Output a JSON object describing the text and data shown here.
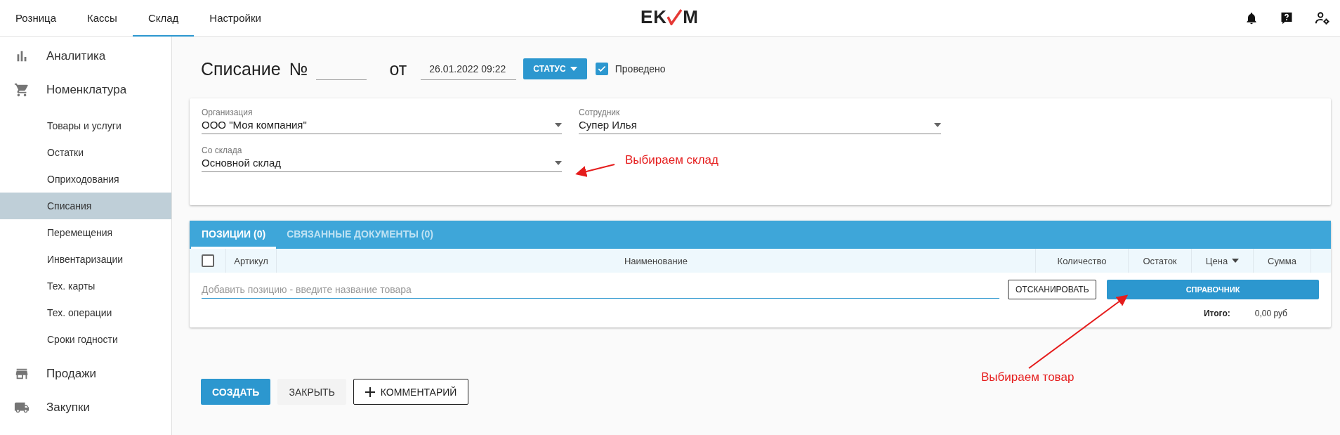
{
  "top_nav": {
    "tabs": [
      {
        "label": "Розница",
        "selected": false
      },
      {
        "label": "Кассы",
        "selected": false
      },
      {
        "label": "Склад",
        "selected": true
      },
      {
        "label": "Настройки",
        "selected": false
      }
    ],
    "logo": {
      "left": "EK",
      "right": "M"
    }
  },
  "sidebar": {
    "items": [
      {
        "label": "Аналитика",
        "selected": false
      },
      {
        "label": "Номенклатура",
        "selected": false,
        "children": [
          {
            "label": "Товары и услуги",
            "selected": false
          },
          {
            "label": "Остатки",
            "selected": false
          },
          {
            "label": "Оприходования",
            "selected": false
          },
          {
            "label": "Списания",
            "selected": true
          },
          {
            "label": "Перемещения",
            "selected": false
          },
          {
            "label": "Инвентаризации",
            "selected": false
          },
          {
            "label": "Тех. карты",
            "selected": false
          },
          {
            "label": "Тех. операции",
            "selected": false
          },
          {
            "label": "Сроки годности",
            "selected": false
          }
        ]
      },
      {
        "label": "Продажи",
        "selected": false
      },
      {
        "label": "Закупки",
        "selected": false
      }
    ]
  },
  "document": {
    "title": "Списание",
    "number_label": "№",
    "date_label": "от",
    "date": "26.01.2022 09:22",
    "status_button": "СТАТУС",
    "posted": {
      "label": "Проведено",
      "checked": true
    }
  },
  "fields": [
    {
      "label": "Организация",
      "value": "ООО \"Моя компания\""
    },
    {
      "label": "Сотрудник",
      "value": "Супер Илья"
    },
    {
      "label": "Со склада",
      "value": "Основной склад"
    }
  ],
  "positions": {
    "tabs": [
      {
        "label": "ПОЗИЦИИ (0)",
        "selected": true
      },
      {
        "label": "СВЯЗАННЫЕ ДОКУМЕНТЫ (0)",
        "selected": false
      }
    ],
    "select_all": {
      "checked": false
    },
    "columns": [
      "Артикул",
      "Наименование",
      "Количество",
      "Остаток",
      "Цена",
      "Сумма"
    ],
    "add_placeholder": "Добавить позицию - введите название товара",
    "scan_button": "ОТСКАНИРОВАТЬ",
    "catalog_button": "СПРАВОЧНИК",
    "total_label": "Итого:",
    "total_value": "0,00 руб"
  },
  "actions": [
    {
      "label": "СОЗДАТЬ",
      "kind": "primary"
    },
    {
      "label": "ЗАКРЫТЬ",
      "kind": "flat"
    },
    {
      "label": "КОММЕНТАРИЙ",
      "kind": "outlined"
    }
  ],
  "annotations": [
    {
      "text": "Выбираем склад"
    },
    {
      "text": "Выбираем товар"
    }
  ]
}
